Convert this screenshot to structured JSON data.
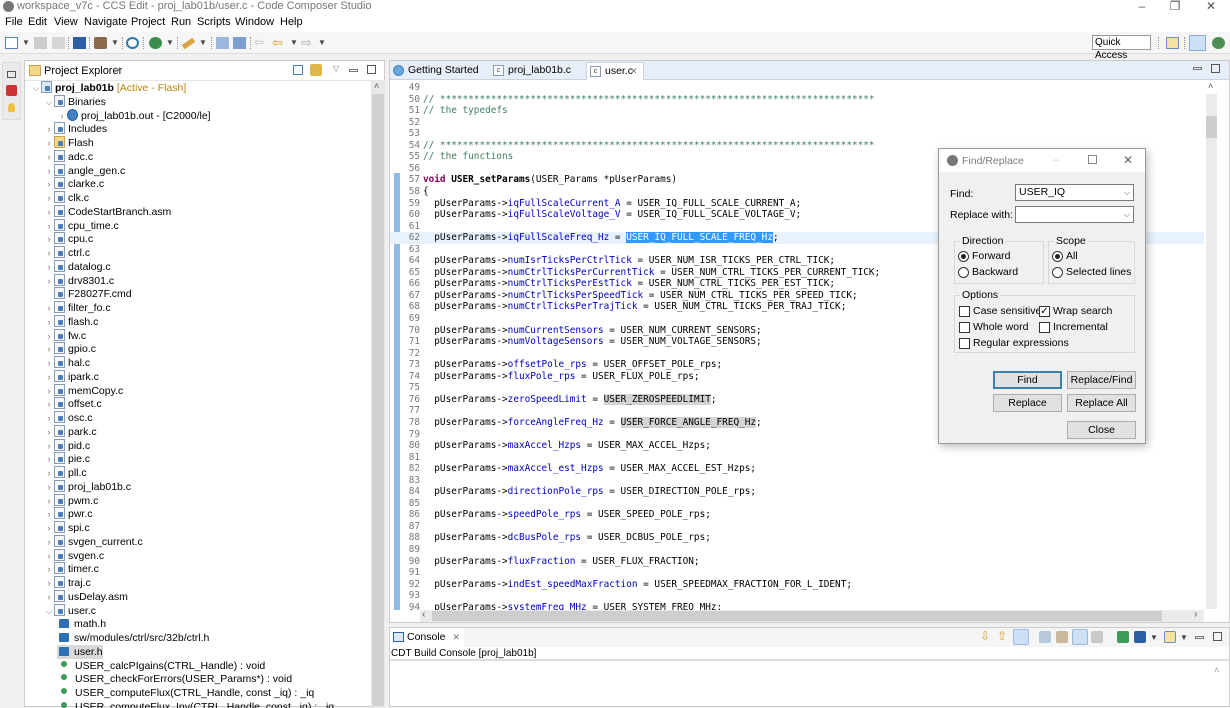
{
  "window": {
    "title": "workspace_v7c - CCS Edit - proj_lab01b/user.c - Code Composer Studio",
    "minimize": "–",
    "restore": "❐",
    "close": "✕"
  },
  "menu": [
    "File",
    "Edit",
    "View",
    "Navigate",
    "Project",
    "Run",
    "Scripts",
    "Window",
    "Help"
  ],
  "toolbar": {
    "quick_access": "Quick Access"
  },
  "project_explorer": {
    "title": "Project Explorer",
    "close": "✕",
    "tree": [
      {
        "label": "proj_lab01b",
        "suffix": " [Active - Flash]",
        "level": 0,
        "expanded": true,
        "type": "project"
      },
      {
        "label": "Binaries",
        "level": 1,
        "expanded": true,
        "type": "binaries"
      },
      {
        "label": "proj_lab01b.out - [C2000/le]",
        "level": 2,
        "expanded": false,
        "type": "binary"
      },
      {
        "label": "Includes",
        "level": 1,
        "expanded": false,
        "type": "includes"
      },
      {
        "label": "Flash",
        "level": 1,
        "expanded": false,
        "type": "folder"
      },
      {
        "label": "adc.c",
        "level": 1,
        "type": "c"
      },
      {
        "label": "angle_gen.c",
        "level": 1,
        "type": "c"
      },
      {
        "label": "clarke.c",
        "level": 1,
        "type": "c"
      },
      {
        "label": "clk.c",
        "level": 1,
        "type": "c"
      },
      {
        "label": "CodeStartBranch.asm",
        "level": 1,
        "type": "asm"
      },
      {
        "label": "cpu_time.c",
        "level": 1,
        "type": "c"
      },
      {
        "label": "cpu.c",
        "level": 1,
        "type": "c"
      },
      {
        "label": "ctrl.c",
        "level": 1,
        "type": "c"
      },
      {
        "label": "datalog.c",
        "level": 1,
        "type": "c"
      },
      {
        "label": "drv8301.c",
        "level": 1,
        "type": "c"
      },
      {
        "label": "F28027F.cmd",
        "level": 1,
        "type": "cmd"
      },
      {
        "label": "filter_fo.c",
        "level": 1,
        "type": "c"
      },
      {
        "label": "flash.c",
        "level": 1,
        "type": "c"
      },
      {
        "label": "fw.c",
        "level": 1,
        "type": "c"
      },
      {
        "label": "gpio.c",
        "level": 1,
        "type": "c"
      },
      {
        "label": "hal.c",
        "level": 1,
        "type": "c"
      },
      {
        "label": "ipark.c",
        "level": 1,
        "type": "c"
      },
      {
        "label": "memCopy.c",
        "level": 1,
        "type": "c"
      },
      {
        "label": "offset.c",
        "level": 1,
        "type": "c"
      },
      {
        "label": "osc.c",
        "level": 1,
        "type": "c"
      },
      {
        "label": "park.c",
        "level": 1,
        "type": "c"
      },
      {
        "label": "pid.c",
        "level": 1,
        "type": "c"
      },
      {
        "label": "pie.c",
        "level": 1,
        "type": "c"
      },
      {
        "label": "pll.c",
        "level": 1,
        "type": "c"
      },
      {
        "label": "proj_lab01b.c",
        "level": 1,
        "type": "c"
      },
      {
        "label": "pwm.c",
        "level": 1,
        "type": "c"
      },
      {
        "label": "pwr.c",
        "level": 1,
        "type": "c"
      },
      {
        "label": "spi.c",
        "level": 1,
        "type": "c"
      },
      {
        "label": "svgen_current.c",
        "level": 1,
        "type": "c"
      },
      {
        "label": "svgen.c",
        "level": 1,
        "type": "c"
      },
      {
        "label": "timer.c",
        "level": 1,
        "type": "c"
      },
      {
        "label": "traj.c",
        "level": 1,
        "type": "c"
      },
      {
        "label": "usDelay.asm",
        "level": 1,
        "type": "asm"
      },
      {
        "label": "user.c",
        "level": 1,
        "expanded": true,
        "type": "c"
      },
      {
        "label": "math.h",
        "level": 2,
        "type": "include"
      },
      {
        "label": "sw/modules/ctrl/src/32b/ctrl.h",
        "level": 2,
        "type": "include"
      },
      {
        "label": "user.h",
        "level": 2,
        "type": "include",
        "selected": true
      },
      {
        "label": "USER_calcPIgains(CTRL_Handle) : void",
        "level": 2,
        "type": "function"
      },
      {
        "label": "USER_checkForErrors(USER_Params*) : void",
        "level": 2,
        "type": "function"
      },
      {
        "label": "USER_computeFlux(CTRL_Handle, const _iq) : _iq",
        "level": 2,
        "type": "function"
      },
      {
        "label": "USER_computeFlux_Inv(CTRL_Handle, const _iq) : _iq",
        "level": 2,
        "type": "function"
      }
    ]
  },
  "editor": {
    "tabs": [
      {
        "label": "Getting Started",
        "active": false
      },
      {
        "label": "proj_lab01b.c",
        "active": false
      },
      {
        "label": "user.c",
        "active": true,
        "close": "✕"
      }
    ],
    "lines": [
      {
        "n": "49",
        "t": ""
      },
      {
        "n": "50",
        "t": "// *****************************************************************************",
        "cls": "comment"
      },
      {
        "n": "51",
        "t": "// the typedefs",
        "cls": "comment"
      },
      {
        "n": "52",
        "t": ""
      },
      {
        "n": "53",
        "t": ""
      },
      {
        "n": "54",
        "t": "// *****************************************************************************",
        "cls": "comment"
      },
      {
        "n": "55",
        "t": "// the functions",
        "cls": "comment"
      },
      {
        "n": "56",
        "t": ""
      },
      {
        "n": "57",
        "kw": "void",
        "fn": "USER_setParams",
        "rest": "(USER_Params *pUserParams)"
      },
      {
        "n": "58",
        "t": "{"
      },
      {
        "n": "59",
        "obj": "  pUserParams->",
        "field": "iqFullScaleCurrent_A",
        "rhs": " = USER_IQ_FULL_SCALE_CURRENT_A;"
      },
      {
        "n": "60",
        "obj": "  pUserParams->",
        "field": "iqFullScaleVoltage_V",
        "rhs": " = USER_IQ_FULL_SCALE_VOLTAGE_V;"
      },
      {
        "n": "61",
        "t": ""
      },
      {
        "n": "62",
        "obj": "  pUserParams->",
        "field": "iqFullScaleFreq_Hz",
        "rhs": " = ",
        "selected": "USER_IQ_FULL_SCALE_FREQ_Hz",
        "end": ";",
        "current": true
      },
      {
        "n": "63",
        "t": ""
      },
      {
        "n": "64",
        "obj": "  pUserParams->",
        "field": "numIsrTicksPerCtrlTick",
        "rhs": " = USER_NUM_ISR_TICKS_PER_CTRL_TICK;"
      },
      {
        "n": "65",
        "obj": "  pUserParams->",
        "field": "numCtrlTicksPerCurrentTick",
        "rhs": " = USER_NUM_CTRL_TICKS_PER_CURRENT_TICK;"
      },
      {
        "n": "66",
        "obj": "  pUserParams->",
        "field": "numCtrlTicksPerEstTick",
        "rhs": " = USER_NUM_CTRL_TICKS_PER_EST_TICK;"
      },
      {
        "n": "67",
        "obj": "  pUserParams->",
        "field": "numCtrlTicksPerSpeedTick",
        "rhs": " = USER_NUM_CTRL_TICKS_PER_SPEED_TICK;"
      },
      {
        "n": "68",
        "obj": "  pUserParams->",
        "field": "numCtrlTicksPerTrajTick",
        "rhs": " = USER_NUM_CTRL_TICKS_PER_TRAJ_TICK;"
      },
      {
        "n": "69",
        "t": ""
      },
      {
        "n": "70",
        "obj": "  pUserParams->",
        "field": "numCurrentSensors",
        "rhs": " = USER_NUM_CURRENT_SENSORS;"
      },
      {
        "n": "71",
        "obj": "  pUserParams->",
        "field": "numVoltageSensors",
        "rhs": " = USER_NUM_VOLTAGE_SENSORS;"
      },
      {
        "n": "72",
        "t": ""
      },
      {
        "n": "73",
        "obj": "  pUserParams->",
        "field": "offsetPole_rps",
        "rhs": " = USER_OFFSET_POLE_rps;"
      },
      {
        "n": "74",
        "obj": "  pUserParams->",
        "field": "fluxPole_rps",
        "rhs": " = USER_FLUX_POLE_rps;"
      },
      {
        "n": "75",
        "t": ""
      },
      {
        "n": "76",
        "obj": "  pUserParams->",
        "field": "zeroSpeedLimit",
        "rhs": " = ",
        "occ": "USER_ZEROSPEEDLIMIT",
        "end": ";"
      },
      {
        "n": "77",
        "t": ""
      },
      {
        "n": "78",
        "obj": "  pUserParams->",
        "field": "forceAngleFreq_Hz",
        "rhs": " = ",
        "occ": "USER_FORCE_ANGLE_FREQ_Hz",
        "end": ";"
      },
      {
        "n": "79",
        "t": ""
      },
      {
        "n": "80",
        "obj": "  pUserParams->",
        "field": "maxAccel_Hzps",
        "rhs": " = USER_MAX_ACCEL_Hzps;"
      },
      {
        "n": "81",
        "t": ""
      },
      {
        "n": "82",
        "obj": "  pUserParams->",
        "field": "maxAccel_est_Hzps",
        "rhs": " = USER_MAX_ACCEL_EST_Hzps;"
      },
      {
        "n": "83",
        "t": ""
      },
      {
        "n": "84",
        "obj": "  pUserParams->",
        "field": "directionPole_rps",
        "rhs": " = USER_DIRECTION_POLE_rps;"
      },
      {
        "n": "85",
        "t": ""
      },
      {
        "n": "86",
        "obj": "  pUserParams->",
        "field": "speedPole_rps",
        "rhs": " = USER_SPEED_POLE_rps;"
      },
      {
        "n": "87",
        "t": ""
      },
      {
        "n": "88",
        "obj": "  pUserParams->",
        "field": "dcBusPole_rps",
        "rhs": " = USER_DCBUS_POLE_rps;"
      },
      {
        "n": "89",
        "t": ""
      },
      {
        "n": "90",
        "obj": "  pUserParams->",
        "field": "fluxFraction",
        "rhs": " = USER_FLUX_FRACTION;"
      },
      {
        "n": "91",
        "t": ""
      },
      {
        "n": "92",
        "obj": "  pUserParams->",
        "field": "indEst_speedMaxFraction",
        "rhs": " = USER_SPEEDMAX_FRACTION_FOR_L_IDENT;"
      },
      {
        "n": "93",
        "t": ""
      },
      {
        "n": "94",
        "obj": "  pUserParams->",
        "field": "systemFreq_MHz",
        "rhs": " = USER_SYSTEM_FREQ_MHz;"
      }
    ]
  },
  "console": {
    "title": "Console",
    "close": "✕",
    "subtitle": "CDT Build Console [proj_lab01b]"
  },
  "find_replace": {
    "title": "Find/Replace",
    "find_label": "Find:",
    "find_value": "USER_IQ",
    "replace_label": "Replace with:",
    "replace_value": "",
    "direction": {
      "label": "Direction",
      "options": [
        "Forward",
        "Backward"
      ],
      "selected": "Forward"
    },
    "scope": {
      "label": "Scope",
      "options": [
        "All",
        "Selected lines"
      ],
      "selected": "All"
    },
    "options": {
      "label": "Options",
      "case_sensitive": {
        "label": "Case sensitive",
        "checked": false
      },
      "wrap_search": {
        "label": "Wrap search",
        "checked": true
      },
      "whole_word": {
        "label": "Whole word",
        "checked": false
      },
      "incremental": {
        "label": "Incremental",
        "checked": false
      },
      "regex": {
        "label": "Regular expressions",
        "checked": false
      }
    },
    "buttons": {
      "find": "Find",
      "replace_find": "Replace/Find",
      "replace": "Replace",
      "replace_all": "Replace All",
      "close": "Close"
    },
    "check_glyph": "✓"
  }
}
